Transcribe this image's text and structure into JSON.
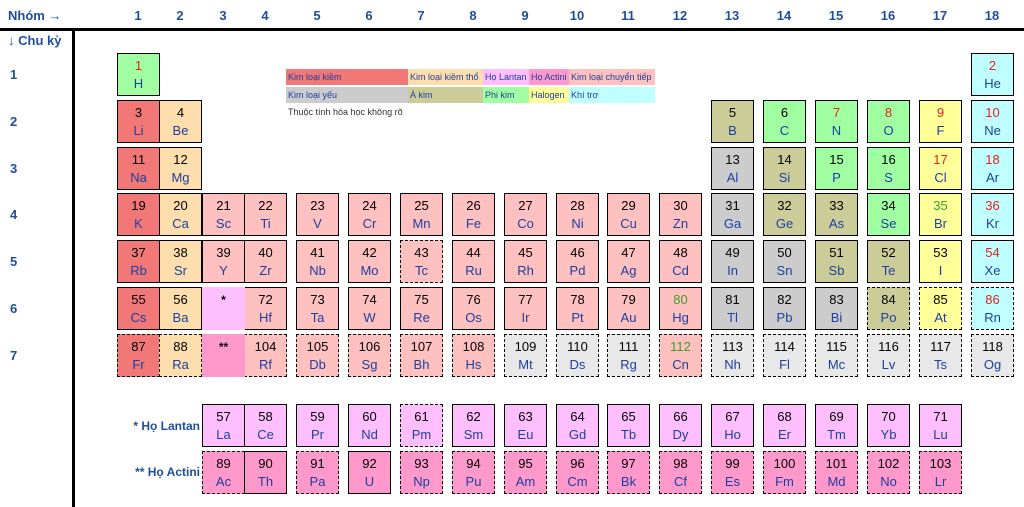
{
  "headers": {
    "group_label": "Nhóm →",
    "period_label": "↓ Chu kỳ",
    "groups": [
      "1",
      "2",
      "3",
      "4",
      "5",
      "6",
      "7",
      "8",
      "9",
      "10",
      "11",
      "12",
      "13",
      "14",
      "15",
      "16",
      "17",
      "18"
    ],
    "periods": [
      "1",
      "2",
      "3",
      "4",
      "5",
      "6",
      "7"
    ]
  },
  "colors": {
    "alkali": "#f27878",
    "alkaline": "#ffdead",
    "transition": "#ffc0c0",
    "post_transition": "#cccccc",
    "metalloid": "#cccc99",
    "nonmetal": "#a0ffa0",
    "halogen": "#ffff99",
    "noble": "#c0ffff",
    "lanthanide": "#ffbfff",
    "actinide": "#ff99cc",
    "unknown": "#e8e8e8"
  },
  "legend": [
    {
      "label": "Kim loại kiềm",
      "cat": "alkali"
    },
    {
      "label": "Kim loại kiềm thổ",
      "cat": "alkaline"
    },
    {
      "label": "Họ Lantan",
      "cat": "lanthanide"
    },
    {
      "label": "Họ Actini",
      "cat": "actinide"
    },
    {
      "label": "Kim loại chuyển tiếp",
      "cat": "transition"
    },
    {
      "label": "Kim loại yếu",
      "cat": "post_transition"
    },
    {
      "label": "Á kim",
      "cat": "metalloid"
    },
    {
      "label": "Phi kim",
      "cat": "nonmetal"
    },
    {
      "label": "Halogen",
      "cat": "halogen"
    },
    {
      "label": "Khí trơ",
      "cat": "noble"
    },
    {
      "label": "Thuộc tính hóa học không rõ",
      "cat": "none"
    }
  ],
  "series_labels": {
    "lanthanides": "* Họ Lantan",
    "actinides": "** Họ Actini"
  },
  "placeholders": {
    "lanthanide_mark": "*",
    "actinide_mark": "**"
  },
  "elements": [
    {
      "n": "1",
      "s": "H",
      "g": 1,
      "p": 1,
      "c": "nonmetal",
      "nc": "red"
    },
    {
      "n": "2",
      "s": "He",
      "g": 18,
      "p": 1,
      "c": "noble",
      "nc": "red"
    },
    {
      "n": "3",
      "s": "Li",
      "g": 1,
      "p": 2,
      "c": "alkali"
    },
    {
      "n": "4",
      "s": "Be",
      "g": 2,
      "p": 2,
      "c": "alkaline"
    },
    {
      "n": "5",
      "s": "B",
      "g": 13,
      "p": 2,
      "c": "metalloid"
    },
    {
      "n": "6",
      "s": "C",
      "g": 14,
      "p": 2,
      "c": "nonmetal"
    },
    {
      "n": "7",
      "s": "N",
      "g": 15,
      "p": 2,
      "c": "nonmetal",
      "nc": "red"
    },
    {
      "n": "8",
      "s": "O",
      "g": 16,
      "p": 2,
      "c": "nonmetal",
      "nc": "red"
    },
    {
      "n": "9",
      "s": "F",
      "g": 17,
      "p": 2,
      "c": "halogen",
      "nc": "red"
    },
    {
      "n": "10",
      "s": "Ne",
      "g": 18,
      "p": 2,
      "c": "noble",
      "nc": "red"
    },
    {
      "n": "11",
      "s": "Na",
      "g": 1,
      "p": 3,
      "c": "alkali"
    },
    {
      "n": "12",
      "s": "Mg",
      "g": 2,
      "p": 3,
      "c": "alkaline"
    },
    {
      "n": "13",
      "s": "Al",
      "g": 13,
      "p": 3,
      "c": "post_transition"
    },
    {
      "n": "14",
      "s": "Si",
      "g": 14,
      "p": 3,
      "c": "metalloid"
    },
    {
      "n": "15",
      "s": "P",
      "g": 15,
      "p": 3,
      "c": "nonmetal"
    },
    {
      "n": "16",
      "s": "S",
      "g": 16,
      "p": 3,
      "c": "nonmetal"
    },
    {
      "n": "17",
      "s": "Cl",
      "g": 17,
      "p": 3,
      "c": "halogen",
      "nc": "red"
    },
    {
      "n": "18",
      "s": "Ar",
      "g": 18,
      "p": 3,
      "c": "noble",
      "nc": "red"
    },
    {
      "n": "19",
      "s": "K",
      "g": 1,
      "p": 4,
      "c": "alkali"
    },
    {
      "n": "20",
      "s": "Ca",
      "g": 2,
      "p": 4,
      "c": "alkaline"
    },
    {
      "n": "21",
      "s": "Sc",
      "g": 3,
      "p": 4,
      "c": "transition"
    },
    {
      "n": "22",
      "s": "Ti",
      "g": 4,
      "p": 4,
      "c": "transition"
    },
    {
      "n": "23",
      "s": "V",
      "g": 5,
      "p": 4,
      "c": "transition"
    },
    {
      "n": "24",
      "s": "Cr",
      "g": 6,
      "p": 4,
      "c": "transition"
    },
    {
      "n": "25",
      "s": "Mn",
      "g": 7,
      "p": 4,
      "c": "transition"
    },
    {
      "n": "26",
      "s": "Fe",
      "g": 8,
      "p": 4,
      "c": "transition"
    },
    {
      "n": "27",
      "s": "Co",
      "g": 9,
      "p": 4,
      "c": "transition"
    },
    {
      "n": "28",
      "s": "Ni",
      "g": 10,
      "p": 4,
      "c": "transition"
    },
    {
      "n": "29",
      "s": "Cu",
      "g": 11,
      "p": 4,
      "c": "transition"
    },
    {
      "n": "30",
      "s": "Zn",
      "g": 12,
      "p": 4,
      "c": "transition"
    },
    {
      "n": "31",
      "s": "Ga",
      "g": 13,
      "p": 4,
      "c": "post_transition"
    },
    {
      "n": "32",
      "s": "Ge",
      "g": 14,
      "p": 4,
      "c": "metalloid"
    },
    {
      "n": "33",
      "s": "As",
      "g": 15,
      "p": 4,
      "c": "metalloid"
    },
    {
      "n": "34",
      "s": "Se",
      "g": 16,
      "p": 4,
      "c": "nonmetal"
    },
    {
      "n": "35",
      "s": "Br",
      "g": 17,
      "p": 4,
      "c": "halogen",
      "nc": "green"
    },
    {
      "n": "36",
      "s": "Kr",
      "g": 18,
      "p": 4,
      "c": "noble",
      "nc": "red"
    },
    {
      "n": "37",
      "s": "Rb",
      "g": 1,
      "p": 5,
      "c": "alkali"
    },
    {
      "n": "38",
      "s": "Sr",
      "g": 2,
      "p": 5,
      "c": "alkaline"
    },
    {
      "n": "39",
      "s": "Y",
      "g": 3,
      "p": 5,
      "c": "transition"
    },
    {
      "n": "40",
      "s": "Zr",
      "g": 4,
      "p": 5,
      "c": "transition"
    },
    {
      "n": "41",
      "s": "Nb",
      "g": 5,
      "p": 5,
      "c": "transition"
    },
    {
      "n": "42",
      "s": "Mo",
      "g": 6,
      "p": 5,
      "c": "transition"
    },
    {
      "n": "43",
      "s": "Tc",
      "g": 7,
      "p": 5,
      "c": "transition",
      "d": true
    },
    {
      "n": "44",
      "s": "Ru",
      "g": 8,
      "p": 5,
      "c": "transition"
    },
    {
      "n": "45",
      "s": "Rh",
      "g": 9,
      "p": 5,
      "c": "transition"
    },
    {
      "n": "46",
      "s": "Pd",
      "g": 10,
      "p": 5,
      "c": "transition"
    },
    {
      "n": "47",
      "s": "Ag",
      "g": 11,
      "p": 5,
      "c": "transition"
    },
    {
      "n": "48",
      "s": "Cd",
      "g": 12,
      "p": 5,
      "c": "transition"
    },
    {
      "n": "49",
      "s": "In",
      "g": 13,
      "p": 5,
      "c": "post_transition"
    },
    {
      "n": "50",
      "s": "Sn",
      "g": 14,
      "p": 5,
      "c": "post_transition"
    },
    {
      "n": "51",
      "s": "Sb",
      "g": 15,
      "p": 5,
      "c": "metalloid"
    },
    {
      "n": "52",
      "s": "Te",
      "g": 16,
      "p": 5,
      "c": "metalloid"
    },
    {
      "n": "53",
      "s": "I",
      "g": 17,
      "p": 5,
      "c": "halogen"
    },
    {
      "n": "54",
      "s": "Xe",
      "g": 18,
      "p": 5,
      "c": "noble",
      "nc": "red"
    },
    {
      "n": "55",
      "s": "Cs",
      "g": 1,
      "p": 6,
      "c": "alkali"
    },
    {
      "n": "56",
      "s": "Ba",
      "g": 2,
      "p": 6,
      "c": "alkaline"
    },
    {
      "n": "72",
      "s": "Hf",
      "g": 4,
      "p": 6,
      "c": "transition"
    },
    {
      "n": "73",
      "s": "Ta",
      "g": 5,
      "p": 6,
      "c": "transition"
    },
    {
      "n": "74",
      "s": "W",
      "g": 6,
      "p": 6,
      "c": "transition"
    },
    {
      "n": "75",
      "s": "Re",
      "g": 7,
      "p": 6,
      "c": "transition"
    },
    {
      "n": "76",
      "s": "Os",
      "g": 8,
      "p": 6,
      "c": "transition"
    },
    {
      "n": "77",
      "s": "Ir",
      "g": 9,
      "p": 6,
      "c": "transition"
    },
    {
      "n": "78",
      "s": "Pt",
      "g": 10,
      "p": 6,
      "c": "transition"
    },
    {
      "n": "79",
      "s": "Au",
      "g": 11,
      "p": 6,
      "c": "transition"
    },
    {
      "n": "80",
      "s": "Hg",
      "g": 12,
      "p": 6,
      "c": "transition",
      "nc": "green"
    },
    {
      "n": "81",
      "s": "Tl",
      "g": 13,
      "p": 6,
      "c": "post_transition"
    },
    {
      "n": "82",
      "s": "Pb",
      "g": 14,
      "p": 6,
      "c": "post_transition"
    },
    {
      "n": "83",
      "s": "Bi",
      "g": 15,
      "p": 6,
      "c": "post_transition"
    },
    {
      "n": "84",
      "s": "Po",
      "g": 16,
      "p": 6,
      "c": "metalloid",
      "d": true
    },
    {
      "n": "85",
      "s": "At",
      "g": 17,
      "p": 6,
      "c": "halogen",
      "d": true
    },
    {
      "n": "86",
      "s": "Rn",
      "g": 18,
      "p": 6,
      "c": "noble",
      "nc": "red",
      "d": true
    },
    {
      "n": "87",
      "s": "Fr",
      "g": 1,
      "p": 7,
      "c": "alkali",
      "d": true
    },
    {
      "n": "88",
      "s": "Ra",
      "g": 2,
      "p": 7,
      "c": "alkaline",
      "d": true
    },
    {
      "n": "104",
      "s": "Rf",
      "g": 4,
      "p": 7,
      "c": "transition",
      "d": true
    },
    {
      "n": "105",
      "s": "Db",
      "g": 5,
      "p": 7,
      "c": "transition",
      "d": true
    },
    {
      "n": "106",
      "s": "Sg",
      "g": 6,
      "p": 7,
      "c": "transition",
      "d": true
    },
    {
      "n": "107",
      "s": "Bh",
      "g": 7,
      "p": 7,
      "c": "transition",
      "d": true
    },
    {
      "n": "108",
      "s": "Hs",
      "g": 8,
      "p": 7,
      "c": "transition",
      "d": true
    },
    {
      "n": "109",
      "s": "Mt",
      "g": 9,
      "p": 7,
      "c": "unknown",
      "d": true
    },
    {
      "n": "110",
      "s": "Ds",
      "g": 10,
      "p": 7,
      "c": "unknown",
      "d": true
    },
    {
      "n": "111",
      "s": "Rg",
      "g": 11,
      "p": 7,
      "c": "unknown",
      "d": true
    },
    {
      "n": "112",
      "s": "Cn",
      "g": 12,
      "p": 7,
      "c": "transition",
      "nc": "green",
      "d": true
    },
    {
      "n": "113",
      "s": "Nh",
      "g": 13,
      "p": 7,
      "c": "unknown",
      "d": true
    },
    {
      "n": "114",
      "s": "Fl",
      "g": 14,
      "p": 7,
      "c": "unknown",
      "d": true
    },
    {
      "n": "115",
      "s": "Mc",
      "g": 15,
      "p": 7,
      "c": "unknown",
      "d": true
    },
    {
      "n": "116",
      "s": "Lv",
      "g": 16,
      "p": 7,
      "c": "unknown",
      "d": true
    },
    {
      "n": "117",
      "s": "Ts",
      "g": 17,
      "p": 7,
      "c": "unknown",
      "d": true
    },
    {
      "n": "118",
      "s": "Og",
      "g": 18,
      "p": 7,
      "c": "unknown",
      "d": true
    }
  ],
  "lanthanides": [
    {
      "n": "57",
      "s": "La"
    },
    {
      "n": "58",
      "s": "Ce"
    },
    {
      "n": "59",
      "s": "Pr"
    },
    {
      "n": "60",
      "s": "Nd"
    },
    {
      "n": "61",
      "s": "Pm",
      "d": true
    },
    {
      "n": "62",
      "s": "Sm"
    },
    {
      "n": "63",
      "s": "Eu"
    },
    {
      "n": "64",
      "s": "Gd"
    },
    {
      "n": "65",
      "s": "Tb"
    },
    {
      "n": "66",
      "s": "Dy"
    },
    {
      "n": "67",
      "s": "Ho"
    },
    {
      "n": "68",
      "s": "Er"
    },
    {
      "n": "69",
      "s": "Tm"
    },
    {
      "n": "70",
      "s": "Yb"
    },
    {
      "n": "71",
      "s": "Lu"
    }
  ],
  "actinides": [
    {
      "n": "89",
      "s": "Ac",
      "d": true
    },
    {
      "n": "90",
      "s": "Th"
    },
    {
      "n": "91",
      "s": "Pa",
      "d": true
    },
    {
      "n": "92",
      "s": "U"
    },
    {
      "n": "93",
      "s": "Np",
      "d": true
    },
    {
      "n": "94",
      "s": "Pu",
      "d": true
    },
    {
      "n": "95",
      "s": "Am",
      "d": true
    },
    {
      "n": "96",
      "s": "Cm",
      "d": true
    },
    {
      "n": "97",
      "s": "Bk",
      "d": true
    },
    {
      "n": "98",
      "s": "Cf",
      "d": true
    },
    {
      "n": "99",
      "s": "Es",
      "d": true
    },
    {
      "n": "100",
      "s": "Fm",
      "d": true
    },
    {
      "n": "101",
      "s": "Md",
      "d": true
    },
    {
      "n": "102",
      "s": "No",
      "d": true
    },
    {
      "n": "103",
      "s": "Lr",
      "d": true
    }
  ]
}
